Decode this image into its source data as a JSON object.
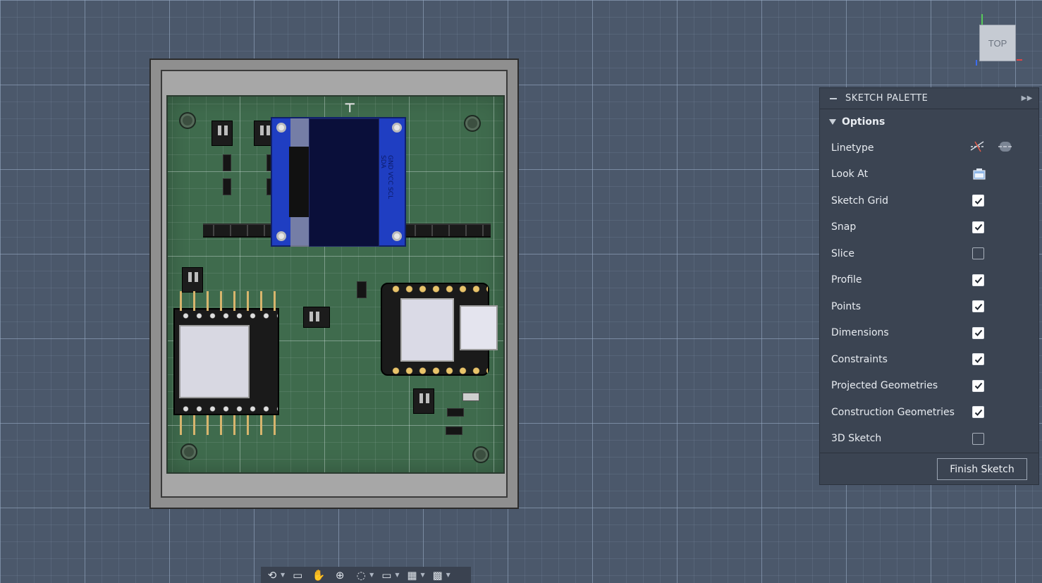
{
  "viewcube": {
    "label": "TOP"
  },
  "oled": {
    "pin_labels": "GND VCC SCL SDA"
  },
  "palette": {
    "title": "SKETCH PALETTE",
    "section": "Options",
    "rows": [
      {
        "label": "Linetype",
        "kind": "icons"
      },
      {
        "label": "Look At",
        "kind": "icon"
      },
      {
        "label": "Sketch Grid",
        "checked": true
      },
      {
        "label": "Snap",
        "checked": true
      },
      {
        "label": "Slice",
        "checked": false
      },
      {
        "label": "Profile",
        "checked": true
      },
      {
        "label": "Points",
        "checked": true
      },
      {
        "label": "Dimensions",
        "checked": true
      },
      {
        "label": "Constraints",
        "checked": true
      },
      {
        "label": "Projected Geometries",
        "checked": true
      },
      {
        "label": "Construction Geometries",
        "checked": true
      },
      {
        "label": "3D Sketch",
        "checked": false
      }
    ],
    "finish_label": "Finish Sketch"
  },
  "navbar": {
    "icons": [
      "orbit-icon",
      "look-at-icon",
      "pan-icon",
      "zoom-icon",
      "fit-icon",
      "display-settings-icon",
      "grid-settings-icon",
      "viewports-icon"
    ]
  },
  "colors": {
    "viewport_bg": "#4b586b",
    "palette_bg": "#3b4452",
    "pcb_green": "#3f6b4d",
    "oled_blue": "#1f3ec2"
  }
}
